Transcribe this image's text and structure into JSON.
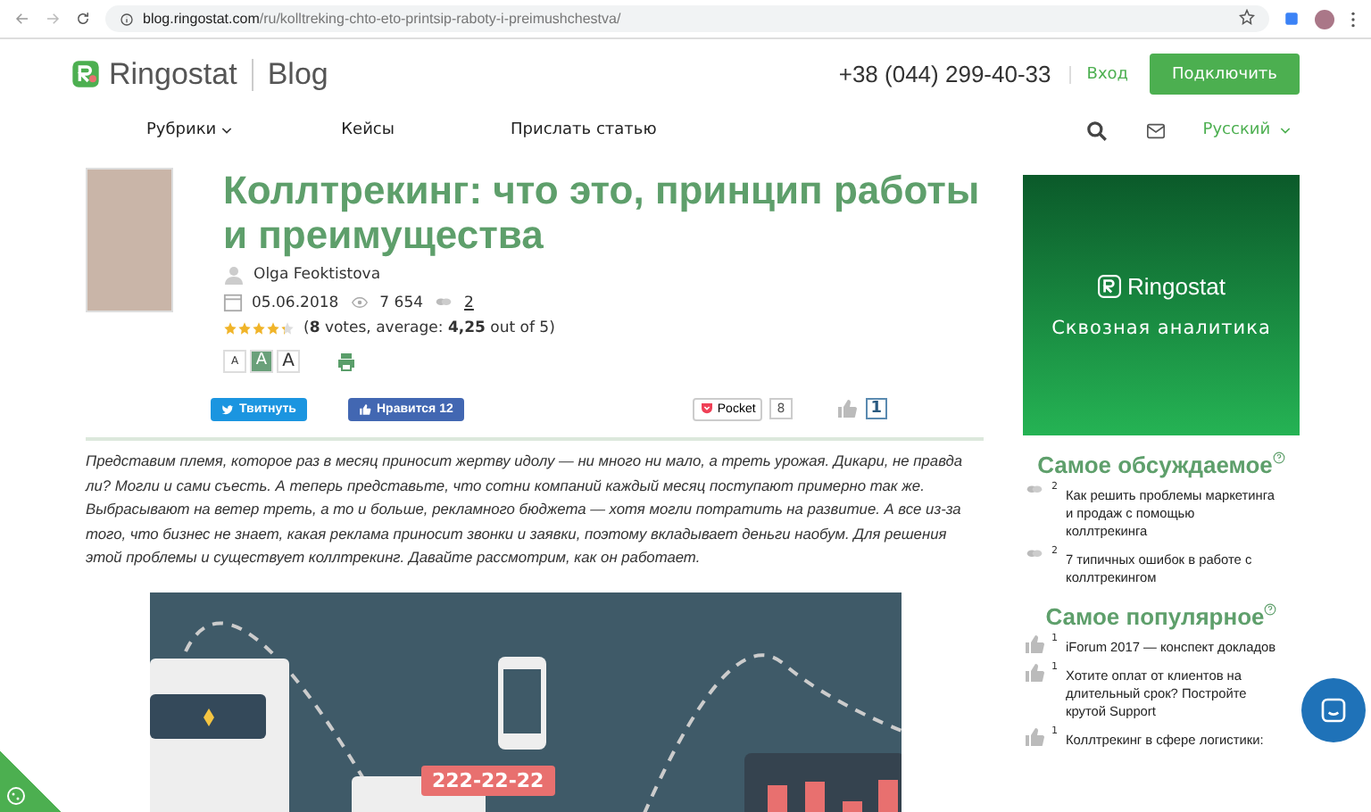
{
  "browser": {
    "url_host": "blog.ringostat.com",
    "url_path": "/ru/kolltreking-chto-eto-printsip-raboty-i-preimushchestva/"
  },
  "header": {
    "logo": "Ringostat",
    "section": "Blog",
    "phone": "+38 (044) 299-40-33",
    "login": "Вход",
    "connect": "Подключить"
  },
  "nav": {
    "items": [
      {
        "label": "Рубрики",
        "kind": "dropdown"
      },
      {
        "label": "Кейсы",
        "kind": "link"
      },
      {
        "label": "Прислать статью",
        "kind": "link"
      }
    ],
    "language": "Русский"
  },
  "article": {
    "title": "Коллтрекинг: что это, принцип работы и преимущества",
    "author": "Olga Feoktistova",
    "date": "05.06.2018",
    "views": "7 654",
    "comments": "2",
    "rating": {
      "stars": 4.25,
      "text": "(**8** votes, average: **4,25** out of 5)"
    },
    "font_sizes": [
      {
        "label": "A",
        "selected": false
      },
      {
        "label": "A",
        "selected": true
      },
      {
        "label": "A",
        "selected": false
      }
    ],
    "share": {
      "tweet": "Твитнуть",
      "like": "Нравится",
      "like_count": "12",
      "pocket": "Pocket",
      "pocket_count": "8",
      "thumbs_count": "1"
    },
    "intro": "Представим племя, которое раз в месяц приносит жертву идолу — ни много ни мало, а треть урожая. Дикари, не правда ли? Могли и сами съесть. А теперь представьте, что сотни компаний каждый месяц поступают примерно так же. Выбрасывают на ветер треть, а то и больше, рекламного бюджета — хотя могли потратить на развитие. А все из-за того, что бизнес не знает, какая реклама приносит звонки и заявки, поэтому вкладывает деньги наобум. Для решения этой проблемы и существует коллтрекинг. Давайте рассмотрим, как он работает.",
    "illustration": {
      "phone_label": "222-22-22"
    }
  },
  "sidebar": {
    "banner": {
      "brand": "Ringostat",
      "tagline": "Сквозная аналитика"
    },
    "sections": [
      {
        "title": "Самое обсуждаемое",
        "kind": "comments",
        "items": [
          {
            "count": "2",
            "title": "Как решить проблемы маркетинга и продаж с помощью коллтрекинга"
          },
          {
            "count": "2",
            "title": "7 типичных ошибок в работе с коллтрекингом"
          }
        ]
      },
      {
        "title": "Самое популярное",
        "kind": "likes",
        "items": [
          {
            "count": "1",
            "title": "iForum 2017 — конспект докладов"
          },
          {
            "count": "1",
            "title": "Хотите оплат от клиентов на длительный срок? Постройте крутой Support"
          },
          {
            "count": "1",
            "title": "Коллтрекинг в сфере логистики:"
          }
        ]
      }
    ]
  }
}
